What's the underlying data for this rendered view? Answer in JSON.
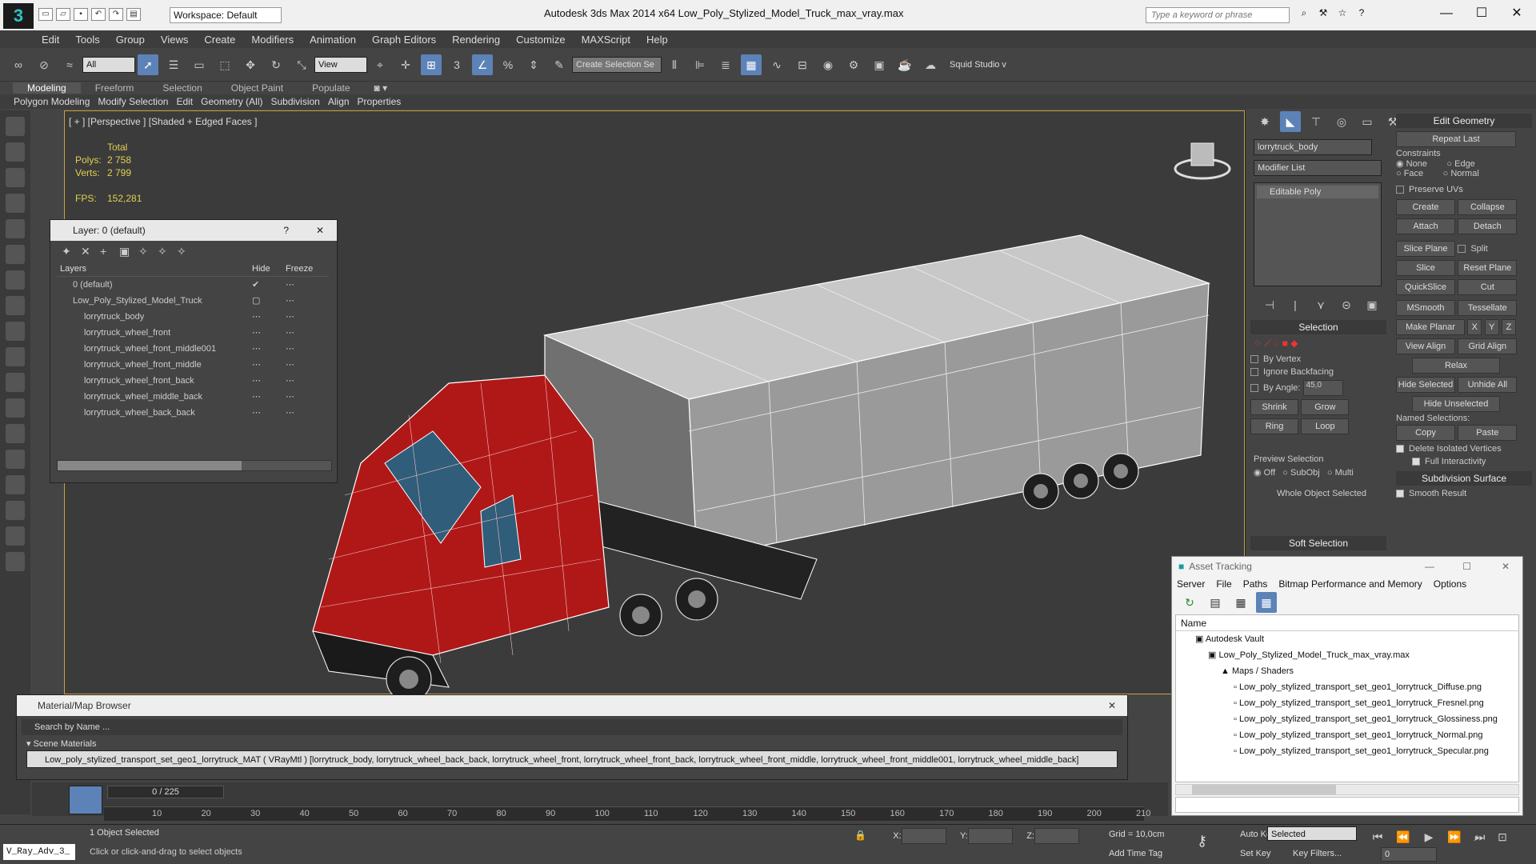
{
  "window": {
    "title": "Autodesk 3ds Max  2014 x64      Low_Poly_Stylized_Model_Truck_max_vray.max",
    "workspace": "Workspace: Default",
    "search_placeholder": "Type a keyword or phrase"
  },
  "menu": [
    "Edit",
    "Tools",
    "Group",
    "Views",
    "Create",
    "Modifiers",
    "Animation",
    "Graph Editors",
    "Rendering",
    "Customize",
    "MAXScript",
    "Help"
  ],
  "toolbar": {
    "filter": "All",
    "refcoord": "View",
    "selection_set_placeholder": "Create Selection Se",
    "studio": "Squid Studio v"
  },
  "ribbon": {
    "tabs": [
      "Modeling",
      "Freeform",
      "Selection",
      "Object Paint",
      "Populate"
    ],
    "subtabs": [
      "Polygon Modeling",
      "Modify Selection",
      "Edit",
      "Geometry (All)",
      "Subdivision",
      "Align",
      "Properties"
    ]
  },
  "viewport": {
    "label": "[ + ] [Perspective ] [Shaded + Edged Faces ]",
    "stats": {
      "total_label": "Total",
      "polys_label": "Polys:",
      "polys": "2 758",
      "verts_label": "Verts:",
      "verts": "2 799",
      "fps_label": "FPS:",
      "fps": "152,281"
    }
  },
  "layer_panel": {
    "title": "Layer: 0 (default)",
    "help": "?",
    "columns": [
      "Layers",
      "Hide",
      "Freeze"
    ],
    "rows": [
      {
        "name": "0 (default)",
        "check": "✔"
      },
      {
        "name": "Low_Poly_Stylized_Model_Truck",
        "check": "▢"
      },
      {
        "name": "lorrytruck_body",
        "check": ""
      },
      {
        "name": "lorrytruck_wheel_front",
        "check": ""
      },
      {
        "name": "lorrytruck_wheel_front_middle001",
        "check": ""
      },
      {
        "name": "lorrytruck_wheel_front_middle",
        "check": ""
      },
      {
        "name": "lorrytruck_wheel_front_back",
        "check": ""
      },
      {
        "name": "lorrytruck_wheel_middle_back",
        "check": ""
      },
      {
        "name": "lorrytruck_wheel_back_back",
        "check": ""
      }
    ]
  },
  "command_panel": {
    "object_name": "lorrytruck_body",
    "modifier_list": "Modifier List",
    "stack": [
      "Editable Poly"
    ],
    "selection": {
      "title": "Selection",
      "by_vertex": "By Vertex",
      "ignore_backfacing": "Ignore Backfacing",
      "by_angle": "By Angle:",
      "angle": "45,0",
      "shrink": "Shrink",
      "grow": "Grow",
      "ring": "Ring",
      "loop": "Loop",
      "preview": "Preview Selection",
      "off": "Off",
      "subobj": "SubObj",
      "multi": "Multi",
      "whole": "Whole Object Selected"
    },
    "soft_selection": "Soft Selection",
    "edit_geometry": {
      "title": "Edit Geometry",
      "repeat_last": "Repeat Last",
      "constraints": "Constraints",
      "none": "None",
      "edge": "Edge",
      "face": "Face",
      "normal": "Normal",
      "preserve_uvs": "Preserve UVs",
      "create": "Create",
      "collapse": "Collapse",
      "attach": "Attach",
      "detach": "Detach",
      "slice_plane": "Slice Plane",
      "split": "Split",
      "slice": "Slice",
      "reset_plane": "Reset Plane",
      "quickslice": "QuickSlice",
      "cut": "Cut",
      "msmooth": "MSmooth",
      "tessellate": "Tessellate",
      "make_planar": "Make Planar",
      "x": "X",
      "y": "Y",
      "z": "Z",
      "view_align": "View Align",
      "grid_align": "Grid Align",
      "relax": "Relax",
      "hide_selected": "Hide Selected",
      "unhide_all": "Unhide All",
      "hide_unselected": "Hide Unselected",
      "named_selections": "Named Selections:",
      "copy": "Copy",
      "paste": "Paste",
      "delete_isolated": "Delete Isolated Vertices",
      "full_interactivity": "Full Interactivity"
    },
    "subdivision_surface": "Subdivision Surface",
    "smooth_result": "Smooth Result"
  },
  "asset_tracking": {
    "title": "Asset Tracking",
    "menu": [
      "Server",
      "File",
      "Paths",
      "Bitmap Performance and Memory",
      "Options"
    ],
    "column": "Name",
    "vault": "Autodesk Vault",
    "file": "Low_Poly_Stylized_Model_Truck_max_vray.max",
    "maps": "Maps / Shaders",
    "textures": [
      "Low_poly_stylized_transport_set_geo1_lorrytruck_Diffuse.png",
      "Low_poly_stylized_transport_set_geo1_lorrytruck_Fresnel.png",
      "Low_poly_stylized_transport_set_geo1_lorrytruck_Glossiness.png",
      "Low_poly_stylized_transport_set_geo1_lorrytruck_Normal.png",
      "Low_poly_stylized_transport_set_geo1_lorrytruck_Specular.png"
    ]
  },
  "material_browser": {
    "title": "Material/Map Browser",
    "search": "Search by Name ...",
    "group": "Scene Materials",
    "item": "Low_poly_stylized_transport_set_geo1_lorrytruck_MAT ( VRayMtl ) [lorrytruck_body, lorrytruck_wheel_back_back, lorrytruck_wheel_front, lorrytruck_wheel_front_back, lorrytruck_wheel_front_middle, lorrytruck_wheel_front_middle001, lorrytruck_wheel_middle_back]"
  },
  "timeline": {
    "frame": "0 / 225",
    "ticks": [
      "10",
      "20",
      "30",
      "40",
      "50",
      "60",
      "70",
      "80",
      "90",
      "100",
      "110",
      "120",
      "130",
      "140",
      "150",
      "160",
      "170",
      "180",
      "190",
      "200",
      "210"
    ]
  },
  "status": {
    "script": "V_Ray_Adv_3_",
    "selected": "1 Object Selected",
    "hint": "Click or click-and-drag to select objects",
    "x_label": "X:",
    "y_label": "Y:",
    "z_label": "Z:",
    "grid": "Grid = 10,0cm",
    "add_time_tag": "Add Time Tag",
    "auto_key": "Auto Key",
    "selected_mode": "Selected",
    "set_key": "Set Key",
    "key_filters": "Key Filters...",
    "frame_value": "0"
  }
}
